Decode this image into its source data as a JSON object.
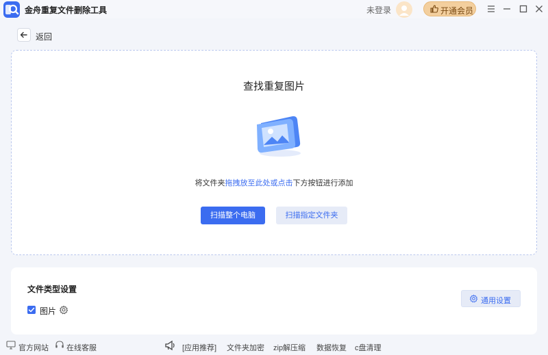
{
  "app": {
    "title": "金舟重复文件删除工具"
  },
  "header": {
    "login_text": "未登录",
    "vip_label": "开通会员"
  },
  "nav": {
    "back_label": "返回"
  },
  "dropzone": {
    "title": "查找重复图片",
    "hint_prefix": "将文件夹",
    "hint_link": "拖拽放至此处或点击",
    "hint_suffix": "下方按钮进行添加",
    "scan_pc_label": "扫描整个电脑",
    "scan_folder_label": "扫描指定文件夹"
  },
  "settings": {
    "title": "文件类型设置",
    "file_type_label": "图片",
    "file_type_checked": true,
    "general_label": "通用设置"
  },
  "footer": {
    "website": "官方网站",
    "support": "在线客服",
    "app_recommend": "[应用推荐]",
    "links": [
      "文件夹加密",
      "zip解压缩",
      "数据恢复",
      "c盘清理"
    ]
  },
  "colors": {
    "accent": "#3b6cf0",
    "vip": "#f3cf9e",
    "background": "#f3f5fa"
  }
}
